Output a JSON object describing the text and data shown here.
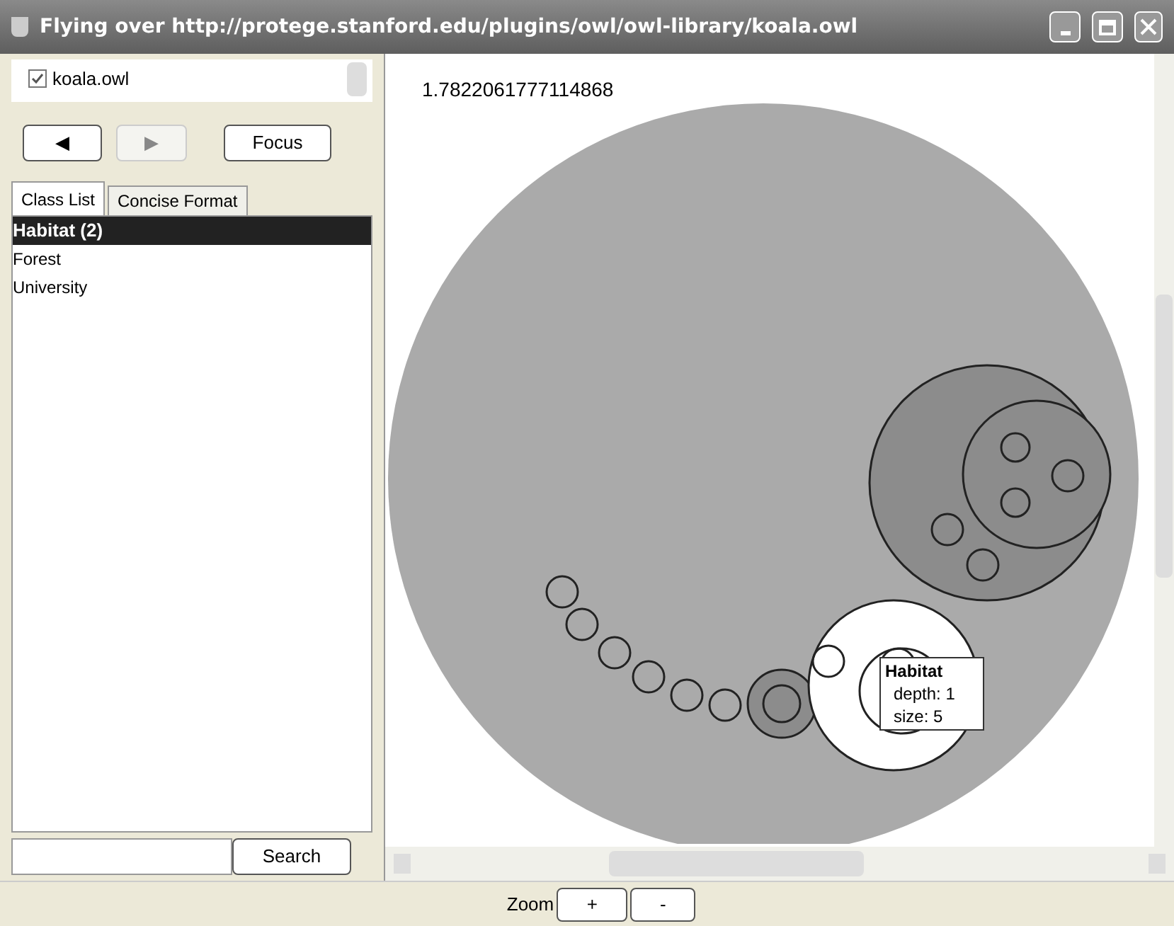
{
  "window": {
    "title": "Flying over http://protege.stanford.edu/plugins/owl/owl-library/koala.owl"
  },
  "ontologies": [
    {
      "label": "koala.owl",
      "checked": true
    }
  ],
  "nav": {
    "back": "◀",
    "forward": "▶",
    "focus": "Focus"
  },
  "tabs": [
    {
      "label": "Class List",
      "selected": true
    },
    {
      "label": "Concise Format",
      "selected": false
    }
  ],
  "classes": [
    {
      "label": "Habitat (2)",
      "selected": true
    },
    {
      "label": "Forest",
      "selected": false
    },
    {
      "label": "University",
      "selected": false
    }
  ],
  "search": {
    "button": "Search"
  },
  "canvas": {
    "value": "1.7822061777114868",
    "tooltip": {
      "title": "Habitat",
      "lines": [
        "depth: 1",
        "size: 5"
      ]
    }
  },
  "zoom": {
    "label": "Zoom",
    "plus": "+",
    "minus": "-"
  }
}
